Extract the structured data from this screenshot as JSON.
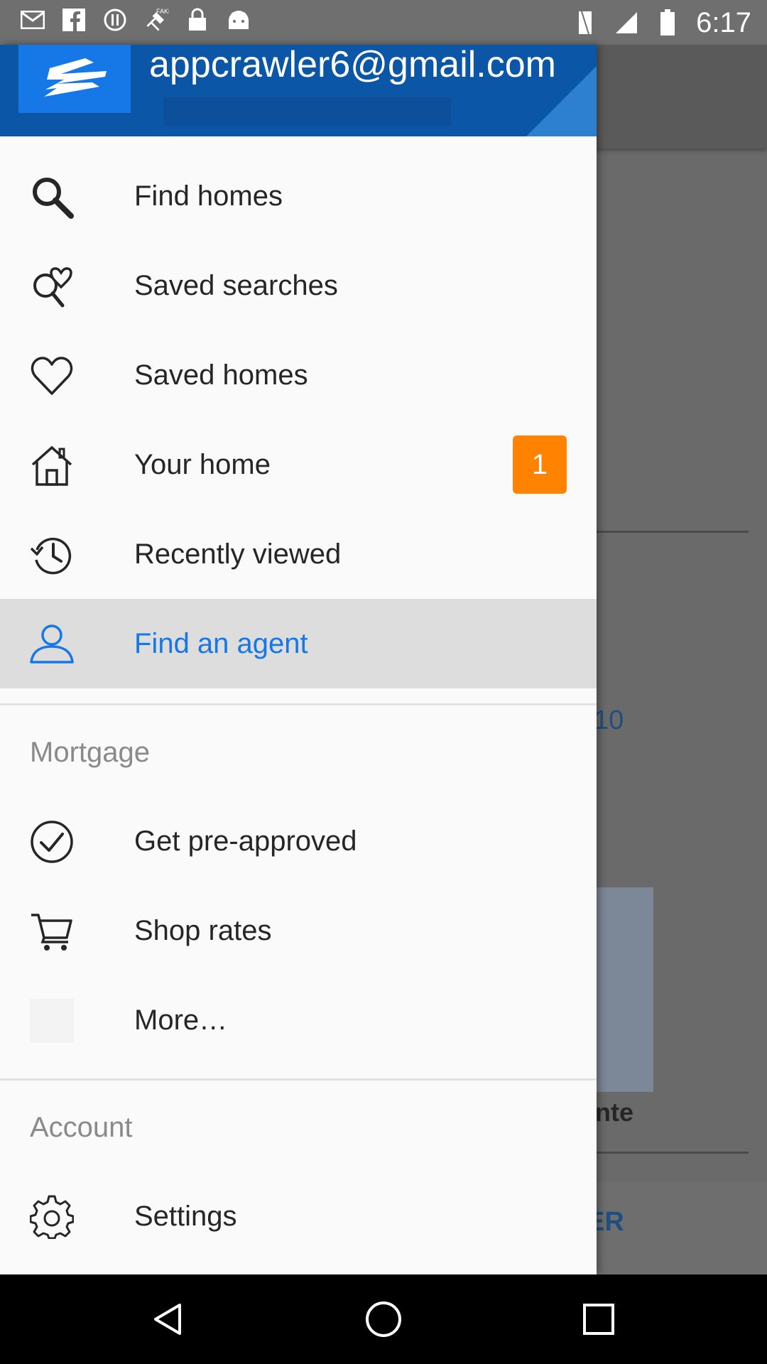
{
  "status_bar": {
    "time": "6:17",
    "left_icons": [
      "mail-icon",
      "facebook-icon",
      "alert-icon",
      "fake-gps-icon",
      "lock-icon",
      "android-icon"
    ],
    "right_icons": [
      "vibrate-icon",
      "signal-icon",
      "battery-icon"
    ]
  },
  "drawer": {
    "account_email": "appcrawler6@gmail.com",
    "items": [
      {
        "label": "Find homes",
        "icon": "search-icon"
      },
      {
        "label": "Saved searches",
        "icon": "saved-searches-icon"
      },
      {
        "label": "Saved homes",
        "icon": "heart-icon"
      },
      {
        "label": "Your home",
        "icon": "house-icon",
        "badge": "1"
      },
      {
        "label": "Recently viewed",
        "icon": "history-icon"
      },
      {
        "label": "Find an agent",
        "icon": "person-icon",
        "active": true
      }
    ],
    "mortgage": {
      "title": "Mortgage",
      "items": [
        {
          "label": "Get pre-approved",
          "icon": "check-circle-icon"
        },
        {
          "label": "Shop rates",
          "icon": "cart-icon"
        },
        {
          "label": "More…",
          "icon": "blank-icon"
        }
      ]
    },
    "account": {
      "title": "Account",
      "items": [
        {
          "label": "Settings",
          "icon": "gear-icon"
        }
      ]
    }
  },
  "background": {
    "partial_number": "10",
    "partial_text": "nte",
    "partial_button": "ER"
  },
  "colors": {
    "accent": "#1677e6",
    "badge": "#ff8200",
    "header": "#0b56a6"
  }
}
